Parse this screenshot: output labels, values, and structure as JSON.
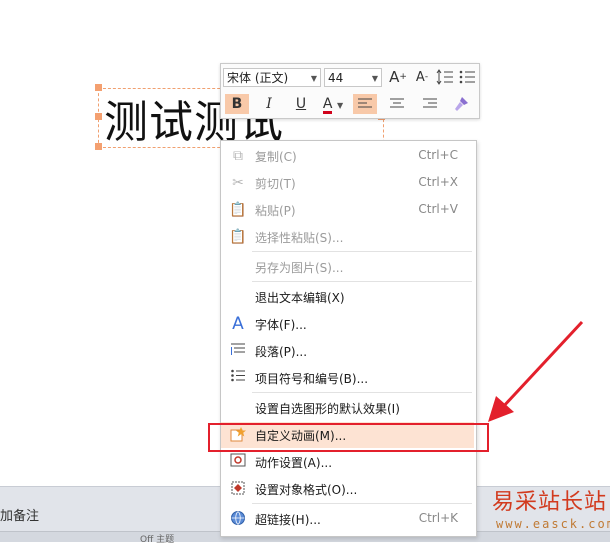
{
  "slide": {
    "text": "测试测试"
  },
  "bottom": {
    "notes_label": "加备注",
    "strip_text": "Off   主题"
  },
  "toolbar": {
    "font_name": "宋体 (正文)",
    "font_size": "44",
    "grow_font": "A",
    "shrink_font": "A",
    "bold": "B",
    "italic": "I",
    "underline": "U",
    "font_color": "A",
    "font_color_value": "#d0021b"
  },
  "menu": {
    "copy": {
      "label": "复制(C)",
      "shortcut": "Ctrl+C"
    },
    "cut": {
      "label": "剪切(T)",
      "shortcut": "Ctrl+X"
    },
    "paste": {
      "label": "粘贴(P)",
      "shortcut": "Ctrl+V"
    },
    "paste_special": {
      "label": "选择性粘贴(S)..."
    },
    "save_as_picture": {
      "label": "另存为图片(S)..."
    },
    "exit_text_edit": {
      "label": "退出文本编辑(X)"
    },
    "font": {
      "label": "字体(F)..."
    },
    "paragraph": {
      "label": "段落(P)..."
    },
    "bullets": {
      "label": "项目符号和编号(B)..."
    },
    "default_shape": {
      "label": "设置自选图形的默认效果(I)"
    },
    "custom_animation": {
      "label": "自定义动画(M)..."
    },
    "action_settings": {
      "label": "动作设置(A)..."
    },
    "format_object": {
      "label": "设置对象格式(O)..."
    },
    "hyperlink": {
      "label": "超链接(H)...",
      "shortcut": "Ctrl+K"
    }
  },
  "watermark": {
    "title": "易采站长站",
    "url": "www.easck.com"
  },
  "colors": {
    "accent": "#f4a070",
    "highlight": "#fde3d3",
    "annotation": "#e3202c"
  }
}
